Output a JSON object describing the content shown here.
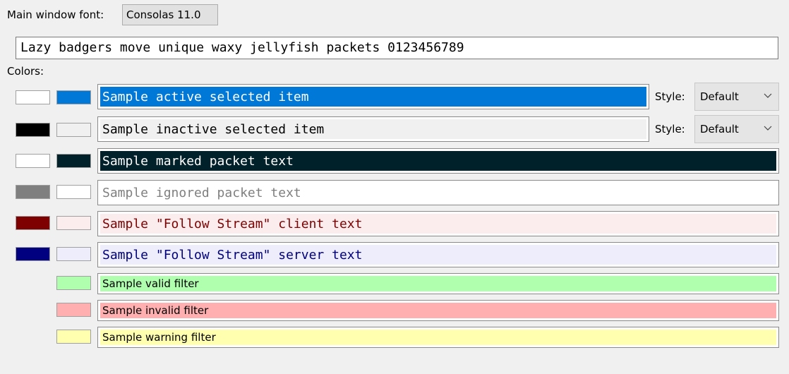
{
  "font": {
    "label": "Main window font:",
    "button": "Consolas  11.0",
    "sample_text": "Lazy badgers move unique waxy jellyfish packets 0123456789"
  },
  "colors_label": "Colors:",
  "style_label": "Style:",
  "rows": [
    {
      "name": "active-selected",
      "text": "Sample active selected item",
      "fg": "#ffffff",
      "bg": "#0078d7",
      "style": "Default"
    },
    {
      "name": "inactive-selected",
      "text": "Sample inactive selected item",
      "fg": "#000000",
      "bg": "#f0f0f0",
      "style": "Default"
    },
    {
      "name": "marked",
      "text": "Sample marked packet text",
      "fg": "#ffffff",
      "bg": "#00202a"
    },
    {
      "name": "ignored",
      "text": "Sample ignored packet text",
      "fg": "#7f7f7f",
      "bg": "#ffffff"
    },
    {
      "name": "follow-client",
      "text": "Sample \"Follow Stream\" client text",
      "fg": "#7f0000",
      "bg": "#fbeded"
    },
    {
      "name": "follow-server",
      "text": "Sample \"Follow Stream\" server text",
      "fg": "#000080",
      "bg": "#ededfb"
    },
    {
      "name": "valid-filter",
      "text": "Sample valid filter",
      "bg": "#afffaf"
    },
    {
      "name": "invalid-filter",
      "text": "Sample invalid filter",
      "bg": "#ffafaf"
    },
    {
      "name": "warning-filter",
      "text": "Sample warning filter",
      "bg": "#ffffaf"
    }
  ]
}
